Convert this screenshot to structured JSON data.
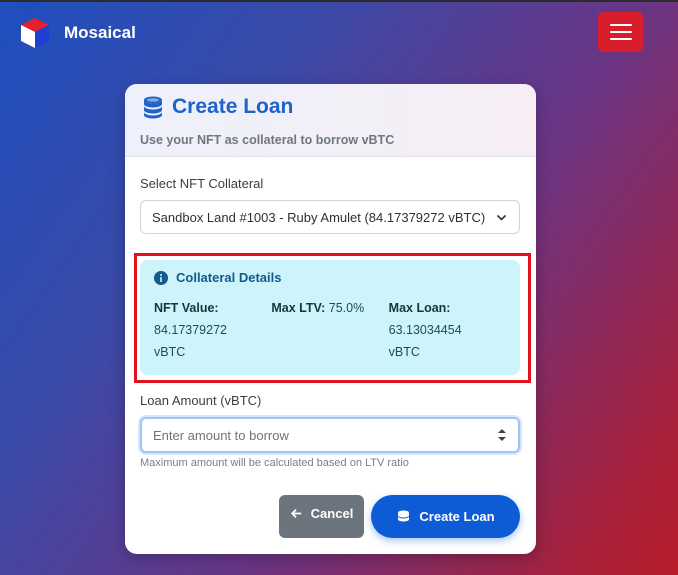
{
  "navbar": {
    "brand_name": "Mosaical",
    "logo_icon": "cube-logo-icon",
    "menu_icon": "hamburger-menu-icon"
  },
  "card": {
    "title": "Create Loan",
    "title_icon": "coins-icon",
    "subtitle": "Use your NFT as collateral to borrow vBTC",
    "select_label": "Select NFT Collateral",
    "selected_nft": "Sandbox Land #1003 - Ruby Amulet (84.17379272 vBTC)",
    "collateral": {
      "heading": "Collateral Details",
      "nft_value_label": "NFT Value:",
      "nft_value": "84.17379272",
      "nft_value_unit": "vBTC",
      "max_ltv_label": "Max LTV:",
      "max_ltv": "75.0%",
      "max_loan_label": "Max Loan:",
      "max_loan": "63.13034454",
      "max_loan_unit": "vBTC"
    },
    "amount_label": "Loan Amount (vBTC)",
    "amount_placeholder": "Enter amount to borrow",
    "amount_value": "",
    "hint": "Maximum amount will be calculated based on LTV ratio",
    "cancel_label": "Cancel",
    "create_label": "Create Loan"
  },
  "colors": {
    "accent": "#1f62c8",
    "primary_button": "#0d5cd6",
    "menu_button": "#d81e2b",
    "highlight_border": "#e0121d",
    "details_bg": "#ccf4fa"
  }
}
